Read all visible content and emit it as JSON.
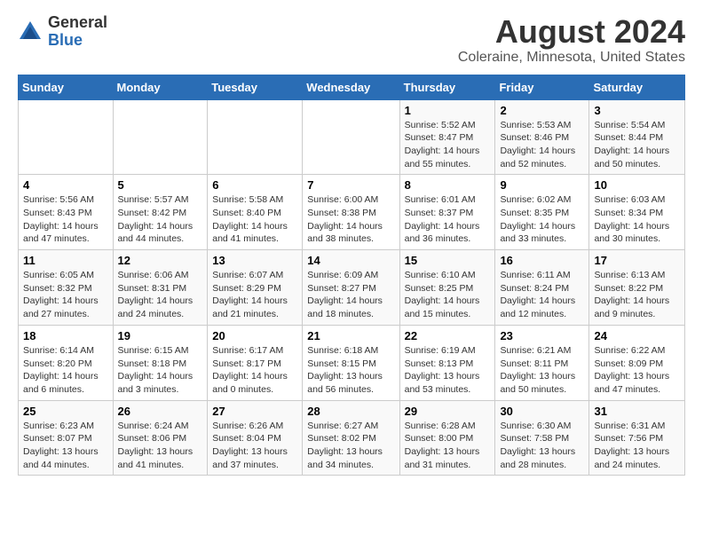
{
  "logo": {
    "general": "General",
    "blue": "Blue"
  },
  "title": "August 2024",
  "subtitle": "Coleraine, Minnesota, United States",
  "headers": [
    "Sunday",
    "Monday",
    "Tuesday",
    "Wednesday",
    "Thursday",
    "Friday",
    "Saturday"
  ],
  "weeks": [
    [
      {
        "day": "",
        "info": ""
      },
      {
        "day": "",
        "info": ""
      },
      {
        "day": "",
        "info": ""
      },
      {
        "day": "",
        "info": ""
      },
      {
        "day": "1",
        "info": "Sunrise: 5:52 AM\nSunset: 8:47 PM\nDaylight: 14 hours and 55 minutes."
      },
      {
        "day": "2",
        "info": "Sunrise: 5:53 AM\nSunset: 8:46 PM\nDaylight: 14 hours and 52 minutes."
      },
      {
        "day": "3",
        "info": "Sunrise: 5:54 AM\nSunset: 8:44 PM\nDaylight: 14 hours and 50 minutes."
      }
    ],
    [
      {
        "day": "4",
        "info": "Sunrise: 5:56 AM\nSunset: 8:43 PM\nDaylight: 14 hours and 47 minutes."
      },
      {
        "day": "5",
        "info": "Sunrise: 5:57 AM\nSunset: 8:42 PM\nDaylight: 14 hours and 44 minutes."
      },
      {
        "day": "6",
        "info": "Sunrise: 5:58 AM\nSunset: 8:40 PM\nDaylight: 14 hours and 41 minutes."
      },
      {
        "day": "7",
        "info": "Sunrise: 6:00 AM\nSunset: 8:38 PM\nDaylight: 14 hours and 38 minutes."
      },
      {
        "day": "8",
        "info": "Sunrise: 6:01 AM\nSunset: 8:37 PM\nDaylight: 14 hours and 36 minutes."
      },
      {
        "day": "9",
        "info": "Sunrise: 6:02 AM\nSunset: 8:35 PM\nDaylight: 14 hours and 33 minutes."
      },
      {
        "day": "10",
        "info": "Sunrise: 6:03 AM\nSunset: 8:34 PM\nDaylight: 14 hours and 30 minutes."
      }
    ],
    [
      {
        "day": "11",
        "info": "Sunrise: 6:05 AM\nSunset: 8:32 PM\nDaylight: 14 hours and 27 minutes."
      },
      {
        "day": "12",
        "info": "Sunrise: 6:06 AM\nSunset: 8:31 PM\nDaylight: 14 hours and 24 minutes."
      },
      {
        "day": "13",
        "info": "Sunrise: 6:07 AM\nSunset: 8:29 PM\nDaylight: 14 hours and 21 minutes."
      },
      {
        "day": "14",
        "info": "Sunrise: 6:09 AM\nSunset: 8:27 PM\nDaylight: 14 hours and 18 minutes."
      },
      {
        "day": "15",
        "info": "Sunrise: 6:10 AM\nSunset: 8:25 PM\nDaylight: 14 hours and 15 minutes."
      },
      {
        "day": "16",
        "info": "Sunrise: 6:11 AM\nSunset: 8:24 PM\nDaylight: 14 hours and 12 minutes."
      },
      {
        "day": "17",
        "info": "Sunrise: 6:13 AM\nSunset: 8:22 PM\nDaylight: 14 hours and 9 minutes."
      }
    ],
    [
      {
        "day": "18",
        "info": "Sunrise: 6:14 AM\nSunset: 8:20 PM\nDaylight: 14 hours and 6 minutes."
      },
      {
        "day": "19",
        "info": "Sunrise: 6:15 AM\nSunset: 8:18 PM\nDaylight: 14 hours and 3 minutes."
      },
      {
        "day": "20",
        "info": "Sunrise: 6:17 AM\nSunset: 8:17 PM\nDaylight: 14 hours and 0 minutes."
      },
      {
        "day": "21",
        "info": "Sunrise: 6:18 AM\nSunset: 8:15 PM\nDaylight: 13 hours and 56 minutes."
      },
      {
        "day": "22",
        "info": "Sunrise: 6:19 AM\nSunset: 8:13 PM\nDaylight: 13 hours and 53 minutes."
      },
      {
        "day": "23",
        "info": "Sunrise: 6:21 AM\nSunset: 8:11 PM\nDaylight: 13 hours and 50 minutes."
      },
      {
        "day": "24",
        "info": "Sunrise: 6:22 AM\nSunset: 8:09 PM\nDaylight: 13 hours and 47 minutes."
      }
    ],
    [
      {
        "day": "25",
        "info": "Sunrise: 6:23 AM\nSunset: 8:07 PM\nDaylight: 13 hours and 44 minutes."
      },
      {
        "day": "26",
        "info": "Sunrise: 6:24 AM\nSunset: 8:06 PM\nDaylight: 13 hours and 41 minutes."
      },
      {
        "day": "27",
        "info": "Sunrise: 6:26 AM\nSunset: 8:04 PM\nDaylight: 13 hours and 37 minutes."
      },
      {
        "day": "28",
        "info": "Sunrise: 6:27 AM\nSunset: 8:02 PM\nDaylight: 13 hours and 34 minutes."
      },
      {
        "day": "29",
        "info": "Sunrise: 6:28 AM\nSunset: 8:00 PM\nDaylight: 13 hours and 31 minutes."
      },
      {
        "day": "30",
        "info": "Sunrise: 6:30 AM\nSunset: 7:58 PM\nDaylight: 13 hours and 28 minutes."
      },
      {
        "day": "31",
        "info": "Sunrise: 6:31 AM\nSunset: 7:56 PM\nDaylight: 13 hours and 24 minutes."
      }
    ]
  ]
}
